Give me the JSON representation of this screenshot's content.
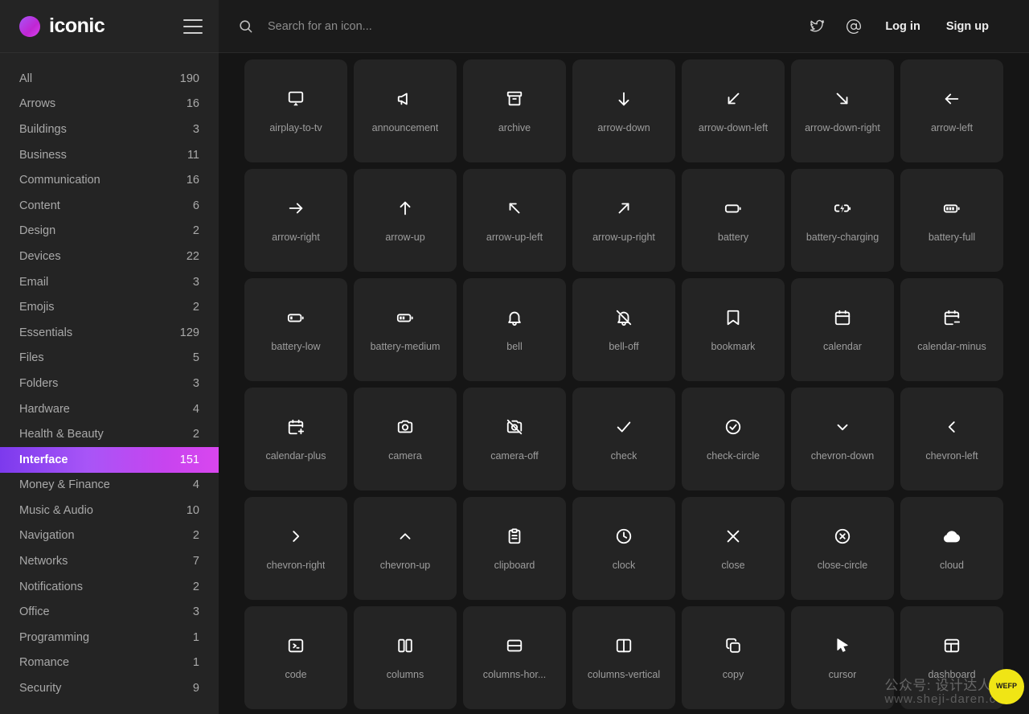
{
  "sidebar": {
    "brand": {
      "name": "iconic",
      "logo_icon": "circle-logo",
      "menu_icon": "hamburger-menu-icon"
    },
    "items": [
      {
        "label": "All",
        "count": "190",
        "active": false
      },
      {
        "label": "Arrows",
        "count": "16",
        "active": false
      },
      {
        "label": "Buildings",
        "count": "3",
        "active": false
      },
      {
        "label": "Business",
        "count": "11",
        "active": false
      },
      {
        "label": "Communication",
        "count": "16",
        "active": false
      },
      {
        "label": "Content",
        "count": "6",
        "active": false
      },
      {
        "label": "Design",
        "count": "2",
        "active": false
      },
      {
        "label": "Devices",
        "count": "22",
        "active": false
      },
      {
        "label": "Email",
        "count": "3",
        "active": false
      },
      {
        "label": "Emojis",
        "count": "2",
        "active": false
      },
      {
        "label": "Essentials",
        "count": "129",
        "active": false
      },
      {
        "label": "Files",
        "count": "5",
        "active": false
      },
      {
        "label": "Folders",
        "count": "3",
        "active": false
      },
      {
        "label": "Hardware",
        "count": "4",
        "active": false
      },
      {
        "label": "Health & Beauty",
        "count": "2",
        "active": false
      },
      {
        "label": "Interface",
        "count": "151",
        "active": true
      },
      {
        "label": "Money & Finance",
        "count": "4",
        "active": false
      },
      {
        "label": "Music & Audio",
        "count": "10",
        "active": false
      },
      {
        "label": "Navigation",
        "count": "2",
        "active": false
      },
      {
        "label": "Networks",
        "count": "7",
        "active": false
      },
      {
        "label": "Notifications",
        "count": "2",
        "active": false
      },
      {
        "label": "Office",
        "count": "3",
        "active": false
      },
      {
        "label": "Programming",
        "count": "1",
        "active": false
      },
      {
        "label": "Romance",
        "count": "1",
        "active": false
      },
      {
        "label": "Security",
        "count": "9",
        "active": false
      }
    ]
  },
  "topbar": {
    "search": {
      "icon": "search-icon",
      "placeholder": "Search for an icon...",
      "value": ""
    },
    "twitter_icon": "twitter-bird-icon",
    "at_icon": "at-sign-icon",
    "login_label": "Log in",
    "signup_label": "Sign up"
  },
  "grid": {
    "icons": [
      {
        "name": "airplay-to-tv",
        "glyph": "airplay-to-tv"
      },
      {
        "name": "announcement",
        "glyph": "announcement"
      },
      {
        "name": "archive",
        "glyph": "archive"
      },
      {
        "name": "arrow-down",
        "glyph": "arrow-down"
      },
      {
        "name": "arrow-down-left",
        "glyph": "arrow-down-left"
      },
      {
        "name": "arrow-down-right",
        "glyph": "arrow-down-right"
      },
      {
        "name": "arrow-left",
        "glyph": "arrow-left"
      },
      {
        "name": "arrow-right",
        "glyph": "arrow-right"
      },
      {
        "name": "arrow-up",
        "glyph": "arrow-up"
      },
      {
        "name": "arrow-up-left",
        "glyph": "arrow-up-left"
      },
      {
        "name": "arrow-up-right",
        "glyph": "arrow-up-right"
      },
      {
        "name": "battery",
        "glyph": "battery"
      },
      {
        "name": "battery-charging",
        "glyph": "battery-charging"
      },
      {
        "name": "battery-full",
        "glyph": "battery-full"
      },
      {
        "name": "battery-low",
        "glyph": "battery-low"
      },
      {
        "name": "battery-medium",
        "glyph": "battery-medium"
      },
      {
        "name": "bell",
        "glyph": "bell"
      },
      {
        "name": "bell-off",
        "glyph": "bell-off"
      },
      {
        "name": "bookmark",
        "glyph": "bookmark"
      },
      {
        "name": "calendar",
        "glyph": "calendar"
      },
      {
        "name": "calendar-minus",
        "glyph": "calendar-minus"
      },
      {
        "name": "calendar-plus",
        "glyph": "calendar-plus"
      },
      {
        "name": "camera",
        "glyph": "camera"
      },
      {
        "name": "camera-off",
        "glyph": "camera-off"
      },
      {
        "name": "check",
        "glyph": "check"
      },
      {
        "name": "check-circle",
        "glyph": "check-circle"
      },
      {
        "name": "chevron-down",
        "glyph": "chevron-down"
      },
      {
        "name": "chevron-left",
        "glyph": "chevron-left"
      },
      {
        "name": "chevron-right",
        "glyph": "chevron-right"
      },
      {
        "name": "chevron-up",
        "glyph": "chevron-up"
      },
      {
        "name": "clipboard",
        "glyph": "clipboard"
      },
      {
        "name": "clock",
        "glyph": "clock"
      },
      {
        "name": "close",
        "glyph": "close"
      },
      {
        "name": "close-circle",
        "glyph": "close-circle"
      },
      {
        "name": "cloud",
        "glyph": "cloud"
      },
      {
        "name": "code",
        "glyph": "code"
      },
      {
        "name": "columns",
        "glyph": "columns"
      },
      {
        "name": "columns-hor...",
        "glyph": "columns-horizontal"
      },
      {
        "name": "columns-vertical",
        "glyph": "columns-vertical"
      },
      {
        "name": "copy",
        "glyph": "copy"
      },
      {
        "name": "cursor",
        "glyph": "cursor"
      },
      {
        "name": "dashboard",
        "glyph": "dashboard"
      }
    ]
  },
  "watermark": {
    "line1": "公众号: 设计达人",
    "line2": "www.sheji-daren.com",
    "badge_text": "WEFP"
  },
  "colors": {
    "accent_start": "#7c3aed",
    "accent_end": "#d946ef",
    "sidebar_bg": "#242424",
    "main_bg": "#151515",
    "card_bg": "#242424",
    "topbar_bg": "#1b1b1b",
    "badge_yellow": "#f0e515"
  }
}
